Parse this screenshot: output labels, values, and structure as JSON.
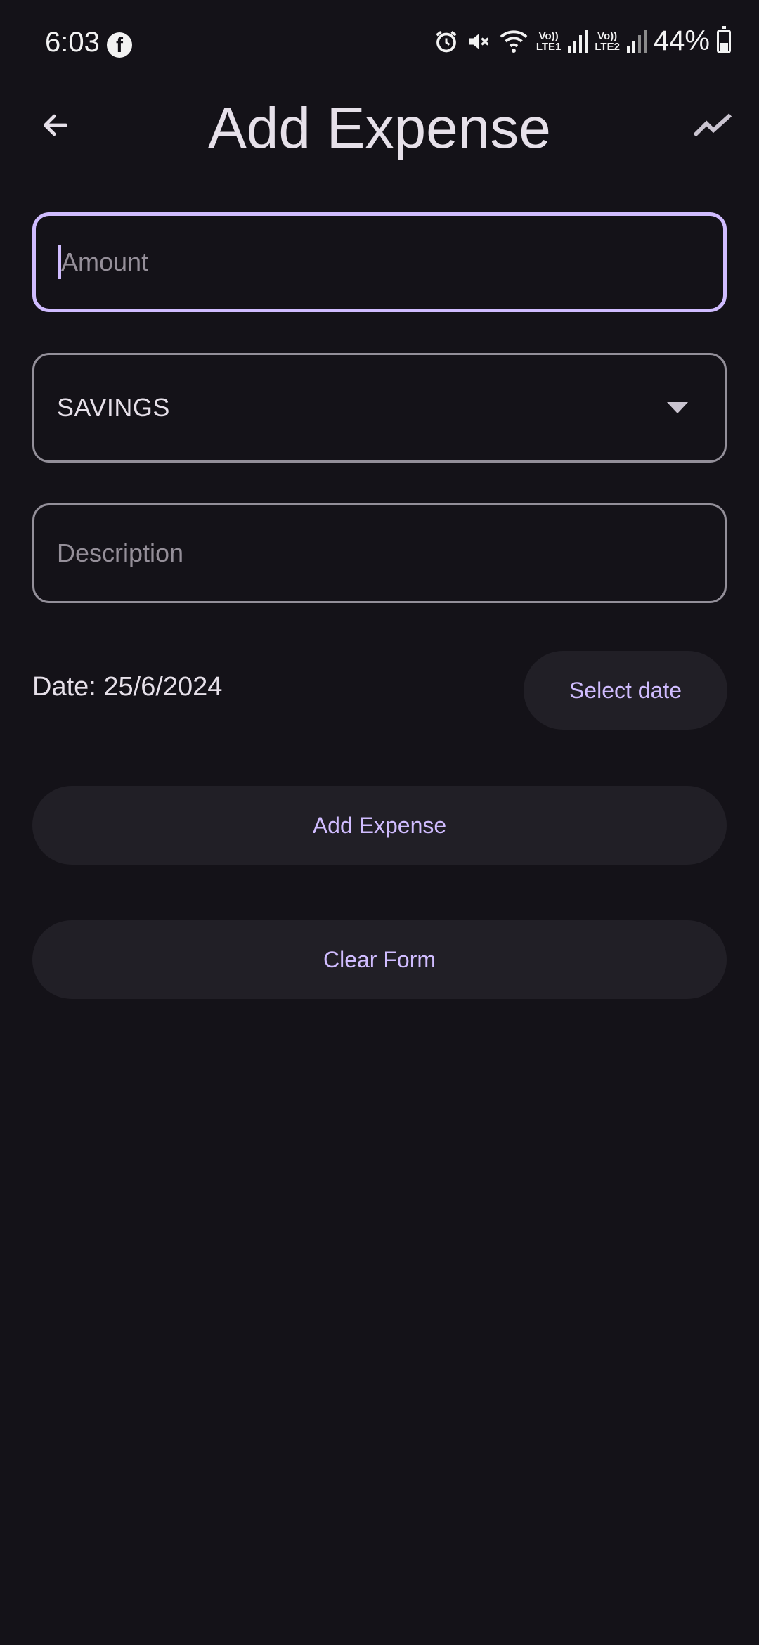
{
  "status_bar": {
    "time": "6:03",
    "facebook_glyph": "f",
    "volte1_top": "Vo))",
    "volte1_bottom": "LTE1",
    "volte2_top": "Vo))",
    "volte2_bottom": "LTE2",
    "battery_percent": "44%",
    "battery_level": 0.44,
    "icons": [
      "facebook-icon",
      "alarm-icon",
      "mute-icon",
      "wifi-icon",
      "signal-icon",
      "battery-icon"
    ]
  },
  "app_bar": {
    "title": "Add Expense",
    "back_icon": "arrow-back-icon",
    "action_icon": "trending-up-icon"
  },
  "form": {
    "amount_placeholder": "Amount",
    "category_value": "SAVINGS",
    "description_placeholder": "Description",
    "date_label": "Date: 25/6/2024",
    "select_date_label": "Select date",
    "add_expense_label": "Add Expense",
    "clear_form_label": "Clear Form"
  },
  "colors": {
    "background": "#141218",
    "accent": "#D0BCFF",
    "button_surface": "#211F26",
    "outline": "#938F99"
  }
}
